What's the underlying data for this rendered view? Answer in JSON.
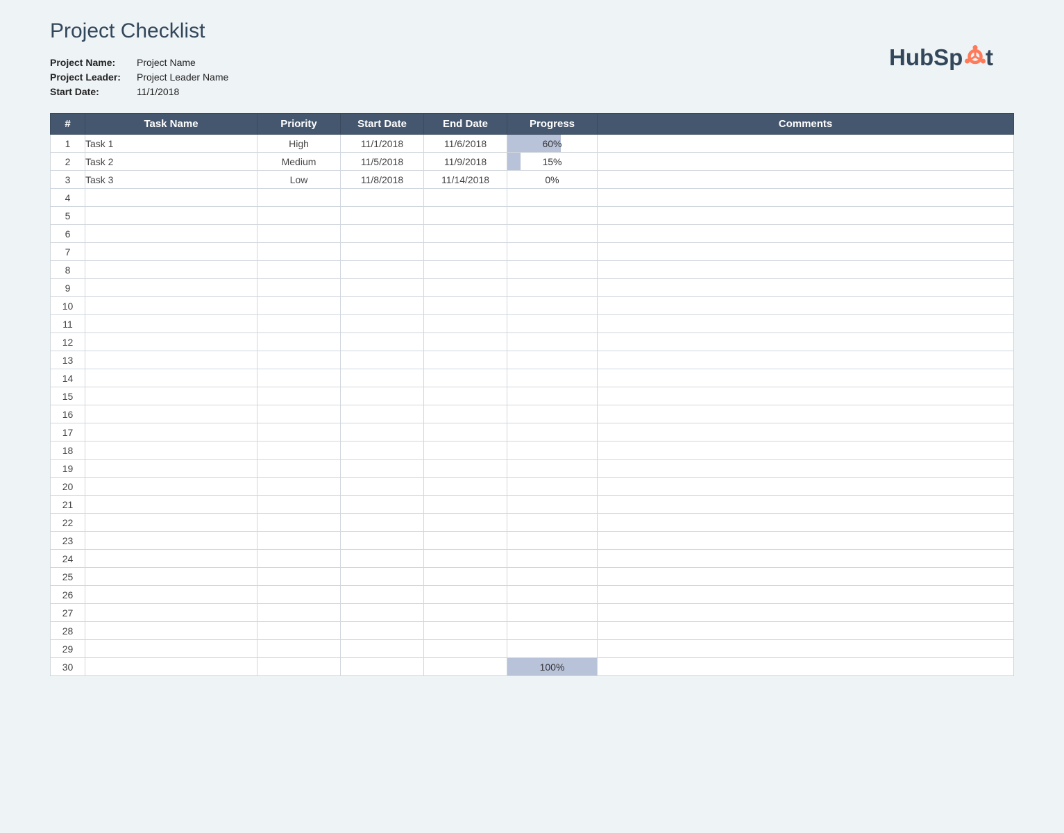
{
  "title": "Project Checklist",
  "meta": {
    "projectNameLabel": "Project Name:",
    "projectNameValue": "Project Name",
    "projectLeaderLabel": "Project Leader:",
    "projectLeaderValue": "Project Leader Name",
    "startDateLabel": "Start Date:",
    "startDateValue": "11/1/2018"
  },
  "logo": {
    "brand": "HubSpot",
    "textColor": "#33475b",
    "accentColor": "#ff7a59"
  },
  "columns": {
    "num": "#",
    "task": "Task Name",
    "priority": "Priority",
    "start": "Start Date",
    "end": "End Date",
    "progress": "Progress",
    "comments": "Comments"
  },
  "priorityColors": {
    "High": "#d9534f",
    "Medium": "#f0ad4e",
    "Low": "#20c997"
  },
  "rows": [
    {
      "num": "1",
      "task": "Task 1",
      "priority": "High",
      "start": "11/1/2018",
      "end": "11/6/2018",
      "progress": "60%",
      "progressPct": 60,
      "comments": ""
    },
    {
      "num": "2",
      "task": "Task 2",
      "priority": "Medium",
      "start": "11/5/2018",
      "end": "11/9/2018",
      "progress": "15%",
      "progressPct": 15,
      "comments": ""
    },
    {
      "num": "3",
      "task": "Task 3",
      "priority": "Low",
      "start": "11/8/2018",
      "end": "11/14/2018",
      "progress": "0%",
      "progressPct": 0,
      "comments": ""
    },
    {
      "num": "4",
      "task": "",
      "priority": "",
      "start": "",
      "end": "",
      "progress": "",
      "progressPct": null,
      "comments": ""
    },
    {
      "num": "5",
      "task": "",
      "priority": "",
      "start": "",
      "end": "",
      "progress": "",
      "progressPct": null,
      "comments": ""
    },
    {
      "num": "6",
      "task": "",
      "priority": "",
      "start": "",
      "end": "",
      "progress": "",
      "progressPct": null,
      "comments": ""
    },
    {
      "num": "7",
      "task": "",
      "priority": "",
      "start": "",
      "end": "",
      "progress": "",
      "progressPct": null,
      "comments": ""
    },
    {
      "num": "8",
      "task": "",
      "priority": "",
      "start": "",
      "end": "",
      "progress": "",
      "progressPct": null,
      "comments": ""
    },
    {
      "num": "9",
      "task": "",
      "priority": "",
      "start": "",
      "end": "",
      "progress": "",
      "progressPct": null,
      "comments": ""
    },
    {
      "num": "10",
      "task": "",
      "priority": "",
      "start": "",
      "end": "",
      "progress": "",
      "progressPct": null,
      "comments": ""
    },
    {
      "num": "11",
      "task": "",
      "priority": "",
      "start": "",
      "end": "",
      "progress": "",
      "progressPct": null,
      "comments": ""
    },
    {
      "num": "12",
      "task": "",
      "priority": "",
      "start": "",
      "end": "",
      "progress": "",
      "progressPct": null,
      "comments": ""
    },
    {
      "num": "13",
      "task": "",
      "priority": "",
      "start": "",
      "end": "",
      "progress": "",
      "progressPct": null,
      "comments": ""
    },
    {
      "num": "14",
      "task": "",
      "priority": "",
      "start": "",
      "end": "",
      "progress": "",
      "progressPct": null,
      "comments": ""
    },
    {
      "num": "15",
      "task": "",
      "priority": "",
      "start": "",
      "end": "",
      "progress": "",
      "progressPct": null,
      "comments": ""
    },
    {
      "num": "16",
      "task": "",
      "priority": "",
      "start": "",
      "end": "",
      "progress": "",
      "progressPct": null,
      "comments": ""
    },
    {
      "num": "17",
      "task": "",
      "priority": "",
      "start": "",
      "end": "",
      "progress": "",
      "progressPct": null,
      "comments": ""
    },
    {
      "num": "18",
      "task": "",
      "priority": "",
      "start": "",
      "end": "",
      "progress": "",
      "progressPct": null,
      "comments": ""
    },
    {
      "num": "19",
      "task": "",
      "priority": "",
      "start": "",
      "end": "",
      "progress": "",
      "progressPct": null,
      "comments": ""
    },
    {
      "num": "20",
      "task": "",
      "priority": "",
      "start": "",
      "end": "",
      "progress": "",
      "progressPct": null,
      "comments": ""
    },
    {
      "num": "21",
      "task": "",
      "priority": "",
      "start": "",
      "end": "",
      "progress": "",
      "progressPct": null,
      "comments": ""
    },
    {
      "num": "22",
      "task": "",
      "priority": "",
      "start": "",
      "end": "",
      "progress": "",
      "progressPct": null,
      "comments": ""
    },
    {
      "num": "23",
      "task": "",
      "priority": "",
      "start": "",
      "end": "",
      "progress": "",
      "progressPct": null,
      "comments": ""
    },
    {
      "num": "24",
      "task": "",
      "priority": "",
      "start": "",
      "end": "",
      "progress": "",
      "progressPct": null,
      "comments": ""
    },
    {
      "num": "25",
      "task": "",
      "priority": "",
      "start": "",
      "end": "",
      "progress": "",
      "progressPct": null,
      "comments": ""
    },
    {
      "num": "26",
      "task": "",
      "priority": "",
      "start": "",
      "end": "",
      "progress": "",
      "progressPct": null,
      "comments": ""
    },
    {
      "num": "27",
      "task": "",
      "priority": "",
      "start": "",
      "end": "",
      "progress": "",
      "progressPct": null,
      "comments": ""
    },
    {
      "num": "28",
      "task": "",
      "priority": "",
      "start": "",
      "end": "",
      "progress": "",
      "progressPct": null,
      "comments": ""
    },
    {
      "num": "29",
      "task": "",
      "priority": "",
      "start": "",
      "end": "",
      "progress": "",
      "progressPct": null,
      "comments": ""
    },
    {
      "num": "30",
      "task": "",
      "priority": "",
      "start": "",
      "end": "",
      "progress": "100%",
      "progressPct": 100,
      "comments": ""
    }
  ]
}
